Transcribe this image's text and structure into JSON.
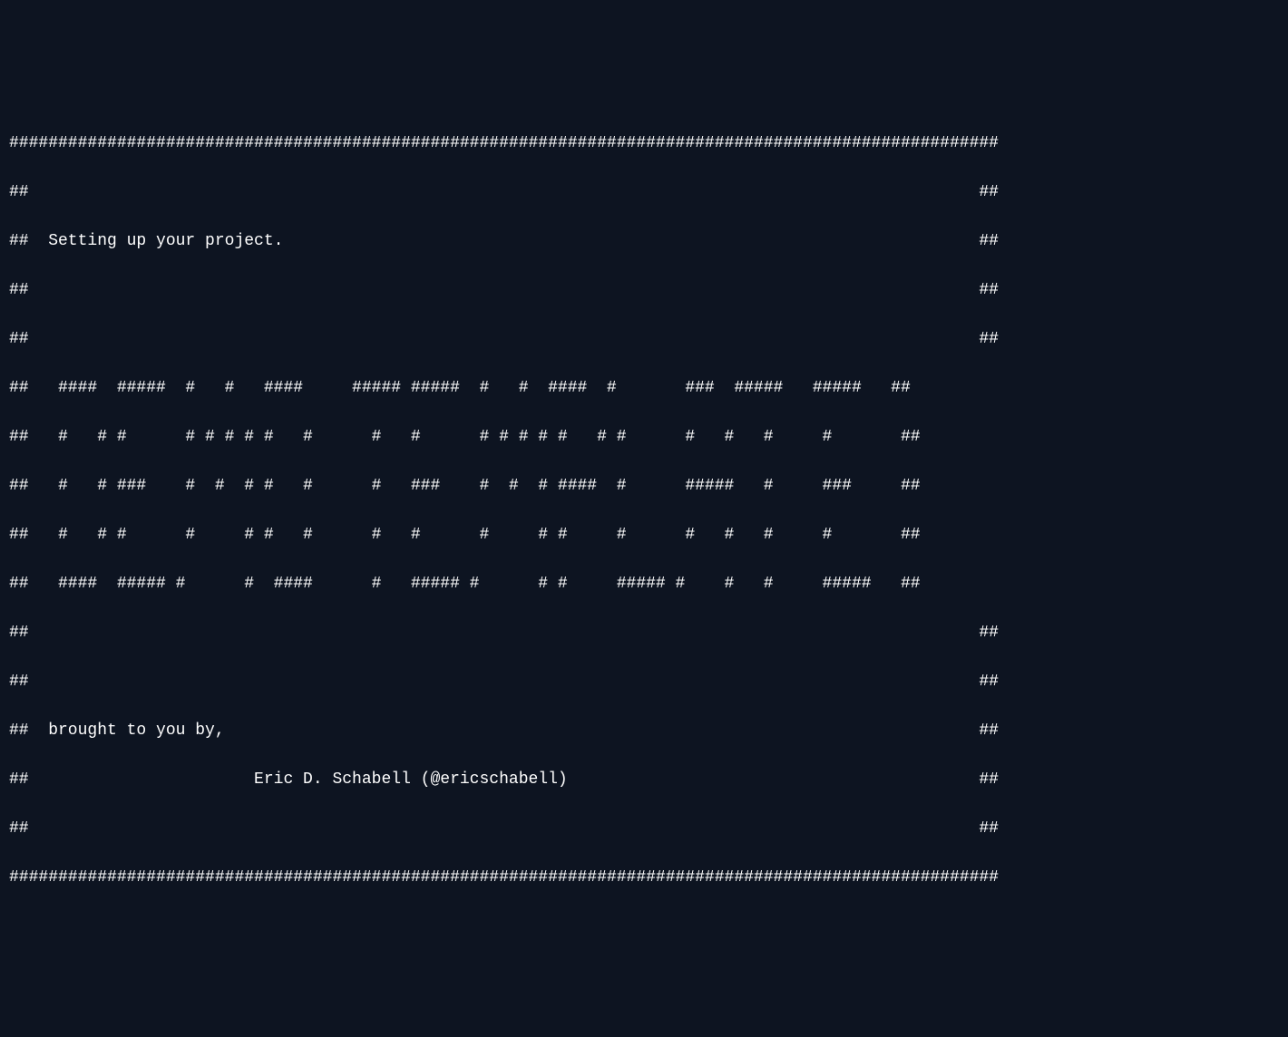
{
  "terminal": {
    "lines": [
      "#####################################################################################################",
      "##                                                                                                 ##",
      "##  Setting up your project.                                                                       ##",
      "##                                                                                                 ##",
      "##                                                                                                 ##",
      "##   ####  #####  #   #   ####     ##### #####  #   #  ####  #       ###  #####   #####   ##",
      "##   #   # #      # # # # #   #      #   #      # # # # #   # #      #   #   #     #       ##",
      "##   #   # ###    #  #  # #   #      #   ###    #  #  # ####  #      #####   #     ###     ##",
      "##   #   # #      #     # #   #      #   #      #     # #     #      #   #   #     #       ##",
      "##   ####  ##### #      #  ####      #   ##### #      # #     ##### #    #   #     #####   ##",
      "##                                                                                                 ##",
      "##                                                                                                 ##",
      "##  brought to you by,                                                                             ##",
      "##                       Eric D. Schabell (@ericschabell)                                          ##",
      "##                                                                                                 ##",
      "#####################################################################################################"
    ]
  }
}
